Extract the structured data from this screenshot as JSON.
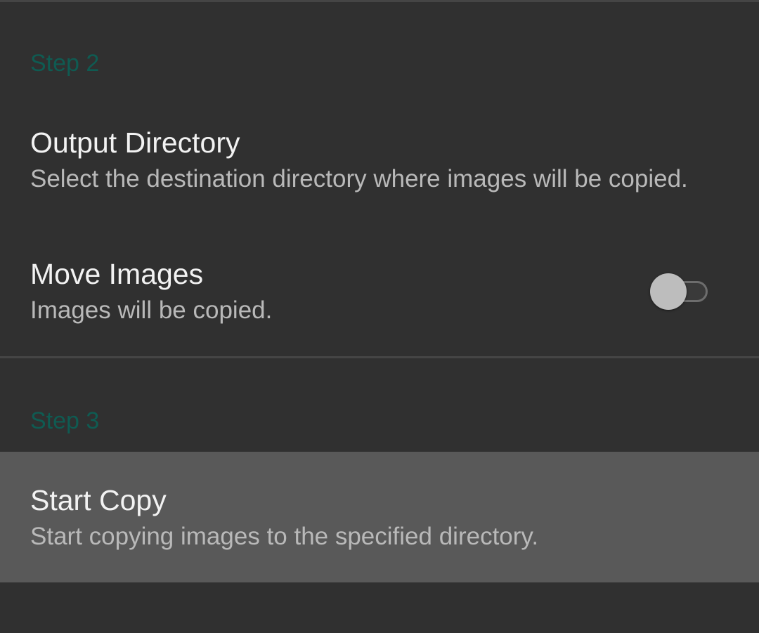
{
  "sections": {
    "step2": {
      "header": "Step 2",
      "output_directory": {
        "title": "Output Directory",
        "summary": "Select the destination directory where images will be copied."
      },
      "move_images": {
        "title": "Move Images",
        "summary": "Images will be copied.",
        "switch_state": "off"
      }
    },
    "step3": {
      "header": "Step 3",
      "start_copy": {
        "title": "Start Copy",
        "summary": "Start copying images to the specified directory.",
        "state": "pressed"
      }
    }
  },
  "colors": {
    "background": "#303030",
    "category_text": "#0f5b52",
    "title_text": "#f2f2f2",
    "summary_text": "#b9b9b9",
    "highlight": "#595959",
    "switch_thumb": "#bdbdbd"
  }
}
